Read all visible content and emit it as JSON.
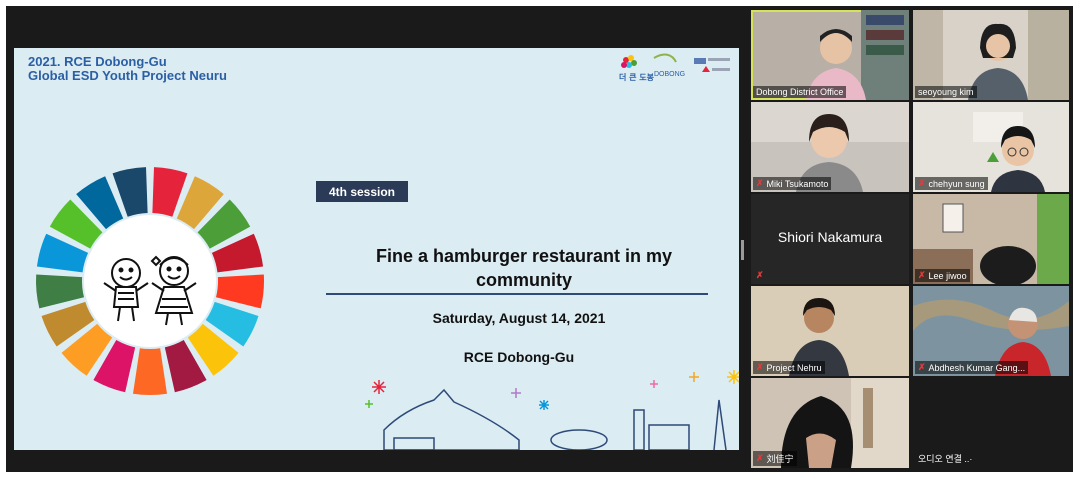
{
  "slide": {
    "title_line1": "2021. RCE Dobong-Gu",
    "title_line2": "Global ESD Youth Project Neuru",
    "logo_text": "더 큰 도봉",
    "logo_brand": "DOBONG",
    "session_badge": "4th session",
    "headline": "Fine a hamburger restaurant in my community",
    "date": "Saturday, August 14, 2021",
    "organizer": "RCE Dobong-Gu"
  },
  "participants": [
    {
      "name": "Dobong District Office",
      "muted": false,
      "active": true
    },
    {
      "name": "seoyoung kim",
      "muted": false,
      "active": false
    },
    {
      "name": "Miki Tsukamoto",
      "muted": true,
      "active": false
    },
    {
      "name": "chehyun sung",
      "muted": true,
      "active": false
    },
    {
      "name": "Shiori Nakamura",
      "muted": true,
      "active": false
    },
    {
      "name": "Lee jiwoo",
      "muted": true,
      "active": false
    },
    {
      "name": "Project Nehru",
      "muted": true,
      "active": false
    },
    {
      "name": "Abdhesh Kumar Gang...",
      "muted": true,
      "active": false
    },
    {
      "name": "刘佳宁",
      "muted": true,
      "active": false
    },
    {
      "name": "오디오 연결 ..·",
      "muted": false,
      "active": false
    }
  ],
  "colors": {
    "sdg": [
      "#e5243b",
      "#dda63a",
      "#4c9f38",
      "#c5192d",
      "#ff3a21",
      "#26bde2",
      "#fcc30b",
      "#a21942",
      "#fd6925",
      "#dd1367",
      "#fd9d24",
      "#bf8b2e",
      "#3f7e44",
      "#0a97d9",
      "#56c02b",
      "#00689d",
      "#19486a"
    ],
    "accent": "#d6e35a"
  }
}
